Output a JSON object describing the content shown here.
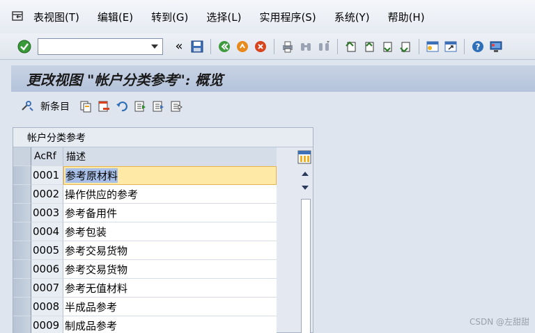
{
  "menubar": {
    "items": [
      "表视图(T)",
      "编辑(E)",
      "转到(G)",
      "选择(L)",
      "实用程序(S)",
      "系统(Y)",
      "帮助(H)"
    ]
  },
  "toolbar": {
    "command_value": "",
    "nav_back": "«"
  },
  "title": "更改视图 \"帐户分类参考\": 概览",
  "app_toolbar": {
    "new_entries_label": "新条目"
  },
  "table": {
    "title": "帐户分类参考",
    "columns": [
      "AcRf",
      "描述"
    ],
    "rows": [
      {
        "key": "0001",
        "desc": "参考原材料"
      },
      {
        "key": "0002",
        "desc": "操作供应的参考"
      },
      {
        "key": "0003",
        "desc": "参考备用件"
      },
      {
        "key": "0004",
        "desc": "参考包装"
      },
      {
        "key": "0005",
        "desc": "参考交易货物"
      },
      {
        "key": "0006",
        "desc": "参考交易货物"
      },
      {
        "key": "0007",
        "desc": "参考无值材料"
      },
      {
        "key": "0008",
        "desc": "半成品参考"
      },
      {
        "key": "0009",
        "desc": "制成品参考"
      }
    ]
  },
  "watermark": "CSDN @左甜甜",
  "colors": {
    "title_bg": "#b4c3db",
    "selected_cell": "#ffe9a6",
    "selected_text_bg": "#a9c1e8"
  }
}
